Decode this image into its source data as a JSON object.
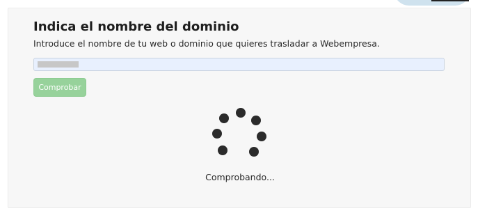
{
  "form": {
    "title": "Indica el nombre del dominio",
    "description": "Introduce el nombre de tu web o dominio que quieres trasladar a Webempresa.",
    "domain_input": {
      "value": "",
      "redacted": true
    },
    "check_button_label": "Comprobar"
  },
  "loading": {
    "status_text": "Comprobando...",
    "spinner_icon": "loading-spinner-icon"
  },
  "colors": {
    "button_bg": "#97d29b",
    "input_bg": "#e8f0fe",
    "card_bg": "#f7f7f7",
    "spinner_dot": "#2b2b2b"
  }
}
